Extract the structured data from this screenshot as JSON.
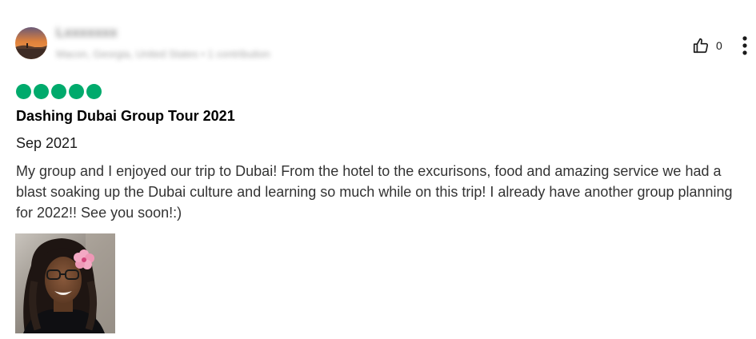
{
  "reviewer": {
    "name": "Lxxxxxxx",
    "meta": "Macon, Georgia, United States • 1 contribution"
  },
  "helpful": {
    "icon": "thumbs-up-icon",
    "count": "0"
  },
  "menu": {
    "icon": "more-vertical-icon"
  },
  "review": {
    "rating": 5,
    "rating_max": 5,
    "rating_color": "#00aa6c",
    "title": "Dashing Dubai Group Tour 2021",
    "date": "Sep 2021",
    "body": "My group and I enjoyed our trip to Dubai! From the hotel to the excurisons, food and amazing service we had a blast soaking up the Dubai culture and learning so much while on this trip! I already have another group planning for 2022!! See you soon!:)"
  }
}
